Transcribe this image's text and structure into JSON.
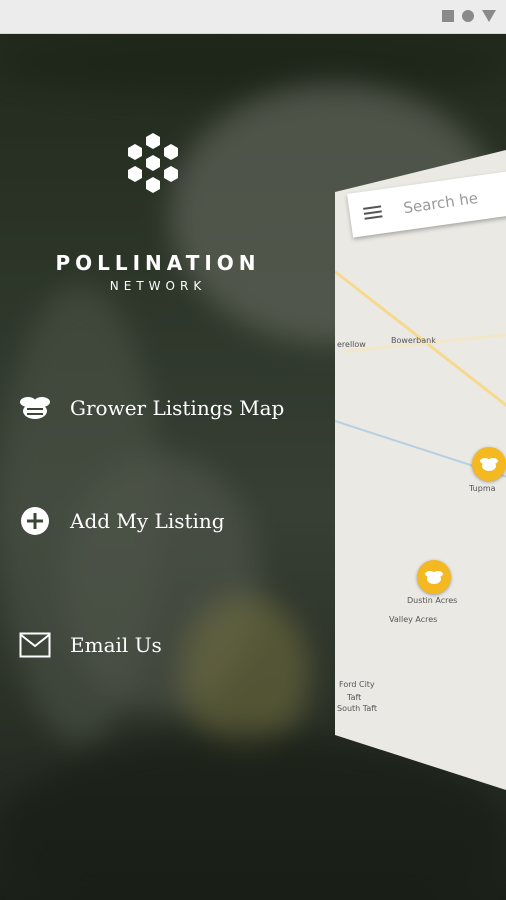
{
  "status_bar": {
    "icons": [
      "square-icon",
      "circle-icon",
      "triangle-icon"
    ]
  },
  "brand": {
    "title": "POLLINATION",
    "subtitle": "NETWORK",
    "logo": "honeycomb-hexagon-icon"
  },
  "menu": {
    "items": [
      {
        "label": "Grower Listings Map",
        "icon": "bee-icon"
      },
      {
        "label": "Add My Listing",
        "icon": "plus-circle-icon"
      },
      {
        "label": "Email Us",
        "icon": "envelope-icon"
      }
    ]
  },
  "map_preview": {
    "search_placeholder": "Search he",
    "towns": [
      "Bowerbank",
      "Tupma",
      "Dustin Acres",
      "Valley Acres",
      "Ford City",
      "Taft",
      "South Taft",
      "erellow"
    ],
    "pins": [
      "pin-tupman",
      "pin-dustin-acres"
    ],
    "colors": {
      "pin": "#f4b820",
      "road": "#f6d98d",
      "land": "#eae9e4"
    }
  },
  "colors": {
    "text": "#ffffff",
    "accent": "#f4b820"
  }
}
